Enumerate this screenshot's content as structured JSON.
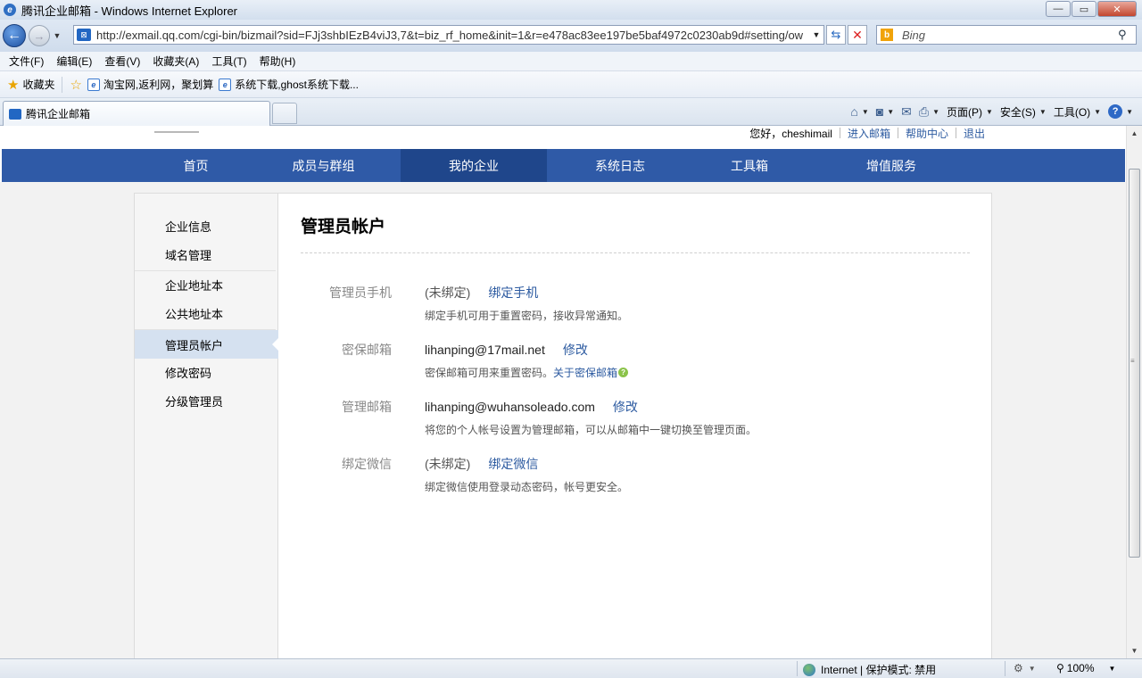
{
  "window": {
    "title": "腾讯企业邮箱 - Windows Internet Explorer",
    "minimize": "—",
    "maximize": "▭",
    "close": "✕"
  },
  "address": {
    "url": "http://exmail.qq.com/cgi-bin/bizmail?sid=FJj3shbIEzB4viJ3,7&t=biz_rf_home&init=1&r=e478ac83ee197be5baf4972c0230ab9d#setting/ow",
    "search_placeholder": "Bing"
  },
  "menu": [
    "文件(F)",
    "编辑(E)",
    "查看(V)",
    "收藏夹(A)",
    "工具(T)",
    "帮助(H)"
  ],
  "favorites": {
    "label": "收藏夹",
    "links": [
      "淘宝网,返利网，聚划算",
      "系统下载,ghost系统下载..."
    ]
  },
  "tab": {
    "label": "腾讯企业邮箱"
  },
  "commands": {
    "page": "页面(P)",
    "safety": "安全(S)",
    "tools": "工具(O)"
  },
  "userbar": {
    "greeting": "您好，cheshimail",
    "enter_mail": "进入邮箱",
    "help": "帮助中心",
    "logout": "退出"
  },
  "nav": {
    "items": [
      "首页",
      "成员与群组",
      "我的企业",
      "系统日志",
      "工具箱",
      "增值服务"
    ],
    "active": "我的企业"
  },
  "sidebar": {
    "items": [
      "企业信息",
      "域名管理",
      "企业地址本",
      "公共地址本",
      "管理员帐户",
      "修改密码",
      "分级管理员"
    ],
    "active": "管理员帐户"
  },
  "content": {
    "title": "管理员帐户",
    "rows": [
      {
        "label": "管理员手机",
        "value": "(未绑定)",
        "action": "绑定手机",
        "note": "绑定手机可用于重置密码，接收异常通知。",
        "note_link": ""
      },
      {
        "label": "密保邮箱",
        "value": "lihanping@17mail.net",
        "action": "修改",
        "note": "密保邮箱可用来重置密码。",
        "note_link": "关于密保邮箱"
      },
      {
        "label": "管理邮箱",
        "value": "lihanping@wuhansoleado.com",
        "action": "修改",
        "note": "将您的个人帐号设置为管理邮箱，可以从邮箱中一键切换至管理页面。",
        "note_link": ""
      },
      {
        "label": "绑定微信",
        "value": "(未绑定)",
        "action": "绑定微信",
        "note": "绑定微信使用登录动态密码，帐号更安全。",
        "note_link": ""
      }
    ]
  },
  "status": {
    "zone": "Internet | 保护模式: 禁用",
    "zoom": "100%"
  },
  "colors": {
    "nav_bg": "#2f5aa7",
    "nav_active": "#1f468b",
    "link": "#2c5aa0",
    "sidebar_active": "#d5e1f0"
  }
}
